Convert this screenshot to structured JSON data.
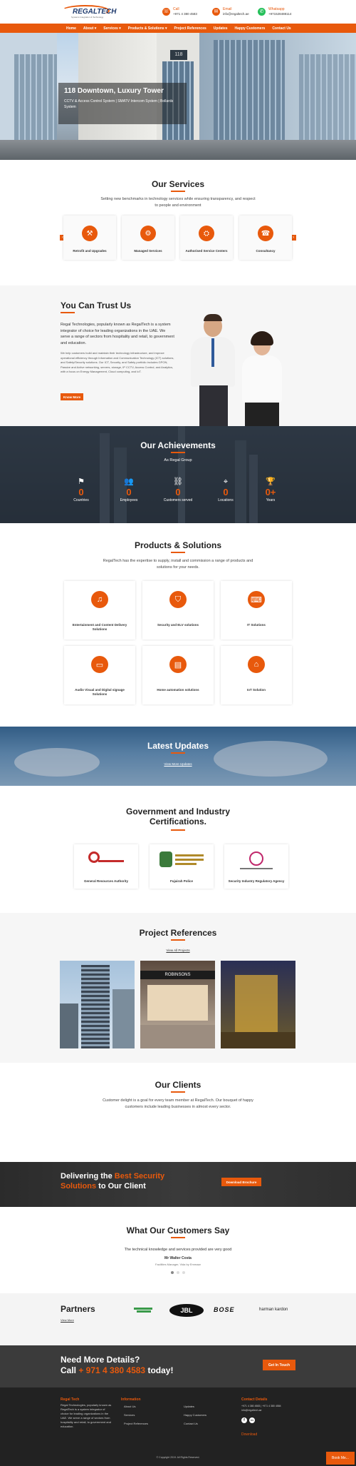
{
  "header": {
    "logo_text": "REGALTECH",
    "logo_tagline": "Systems Integration & Technology",
    "call": {
      "label": "Call",
      "value": "+971 4 380 4583"
    },
    "email": {
      "label": "Email",
      "value": "info@regaltech.ae"
    },
    "whatsapp": {
      "label": "Whatsapp",
      "value": "+971528488114"
    }
  },
  "nav": [
    "Home",
    "About ▾",
    "Services ▾",
    "Products & Solutions ▾",
    "Project References",
    "Updates",
    "Happy Customers",
    "Contact Us"
  ],
  "hero": {
    "title": "118 Downtown, Luxury Tower",
    "subtitle": "CCTV & Access Control System | SMATV Intercom System | Bollards System",
    "sign": "118"
  },
  "services": {
    "title": "Our Services",
    "subtitle": "Setting new benchmarks in technology services while ensuring transparency, and respect to people and environment",
    "items": [
      "Retrofit and Upgrades",
      "Managed Services",
      "Authorised Service Centers",
      "Consultancy"
    ],
    "prev": "‹",
    "next": "›"
  },
  "trust": {
    "title": "You Can Trust Us",
    "lead": "Regal Technologies, popularly known as RegalTech is a system integrator of choice for leading organizations in the UAE. We serve a range of sectors from hospitality and retail, to government and education.",
    "body": "We help customers build and maintain their technology infrastructure, and improve operational efficiency through Information and Communication Technology (ICT) solutions, and Safety/Security solutions. Our ICT, Security, and Safety portfolio includes GPON, Passive and Active networking, servers, storage, IP CCTV, Access Control, and Analytics, with a focus on Energy Management, Cloud computing, and IoT.",
    "button": "Know More"
  },
  "achievements": {
    "title": "Our Achievements",
    "subtitle": "As Regal Group",
    "stats": [
      {
        "value": "0",
        "label": "Countries"
      },
      {
        "value": "0",
        "label": "Employees"
      },
      {
        "value": "0",
        "label": "Customers served"
      },
      {
        "value": "0",
        "label": "Locations"
      },
      {
        "value": "0+",
        "label": "Years"
      }
    ]
  },
  "products": {
    "title": "Products & Solutions",
    "subtitle": "RegalTech has the expertise to supply, install and commission a range of products and solutions for your needs.",
    "items": [
      "Entertainment and Content Delivery Solutions",
      "Security and ELV solutions",
      "IT Solutions",
      "Audio Visual and Digital signage Solutions",
      "Home automation solutions",
      "IoT Solution"
    ]
  },
  "updates": {
    "title": "Latest Updates",
    "link": "View More Updates"
  },
  "certs": {
    "title_line1": "Government and Industry",
    "title_line2": "Certifications.",
    "items": [
      "General Resources Authority",
      "Fujairah Police",
      "Security Industry Regulatory Agency"
    ]
  },
  "projects": {
    "title": "Project References",
    "link": "View All Projects",
    "mall_sign": "ROBINSONS"
  },
  "clients": {
    "title": "Our Clients",
    "subtitle": "Customer delight is a goal for every team member at RegalTech. Our bouquet of happy customers include leading businesses in almost every sector."
  },
  "cta": {
    "line1_a": "Delivering the ",
    "line1_b": "Best Security",
    "line2_a": "Solutions",
    "line2_b": " to Our Client",
    "button": "Download Brochure"
  },
  "testimonials": {
    "title": "What Our Customers Say",
    "quote": "The technical knowledge and services provided are very good",
    "name": "Mr Walter Costa",
    "role": "Facilities Manager, Vida by Emmaar"
  },
  "partners": {
    "title": "Partners",
    "link": "View More",
    "logos": [
      "",
      "JBL",
      "BOSE",
      "harman kardon"
    ]
  },
  "contact_cta": {
    "line1": "Need More Details?",
    "call_label": "Call ",
    "phone": "+ 971 4 380 4583",
    "suffix": " today!",
    "button": "Get In Touch"
  },
  "footer": {
    "col1_title": "Regal Tech",
    "col1_text": "Regal Technologies, popularly known as RegalTech is a system integrator of choice for leading organizations in the UAE. We serve a range of sectors from hospitality and retail, to government and education.",
    "col2_title": "Information",
    "links_a": [
      "About Us",
      "Services",
      "Project References"
    ],
    "links_b": [
      "Updates",
      "Happy Customers",
      "Contact Us"
    ],
    "col4_title": "Contact Details",
    "phone": "+971 4 380 4583 | +971 4 380 4584",
    "email": "info@regaltech.ae",
    "download": "Download",
    "copyright": "© Copyright 2019. All Rights Reserved.",
    "chat": "Book Me..."
  },
  "colors": {
    "accent": "#e8590c",
    "dark": "#2b2b2b"
  }
}
